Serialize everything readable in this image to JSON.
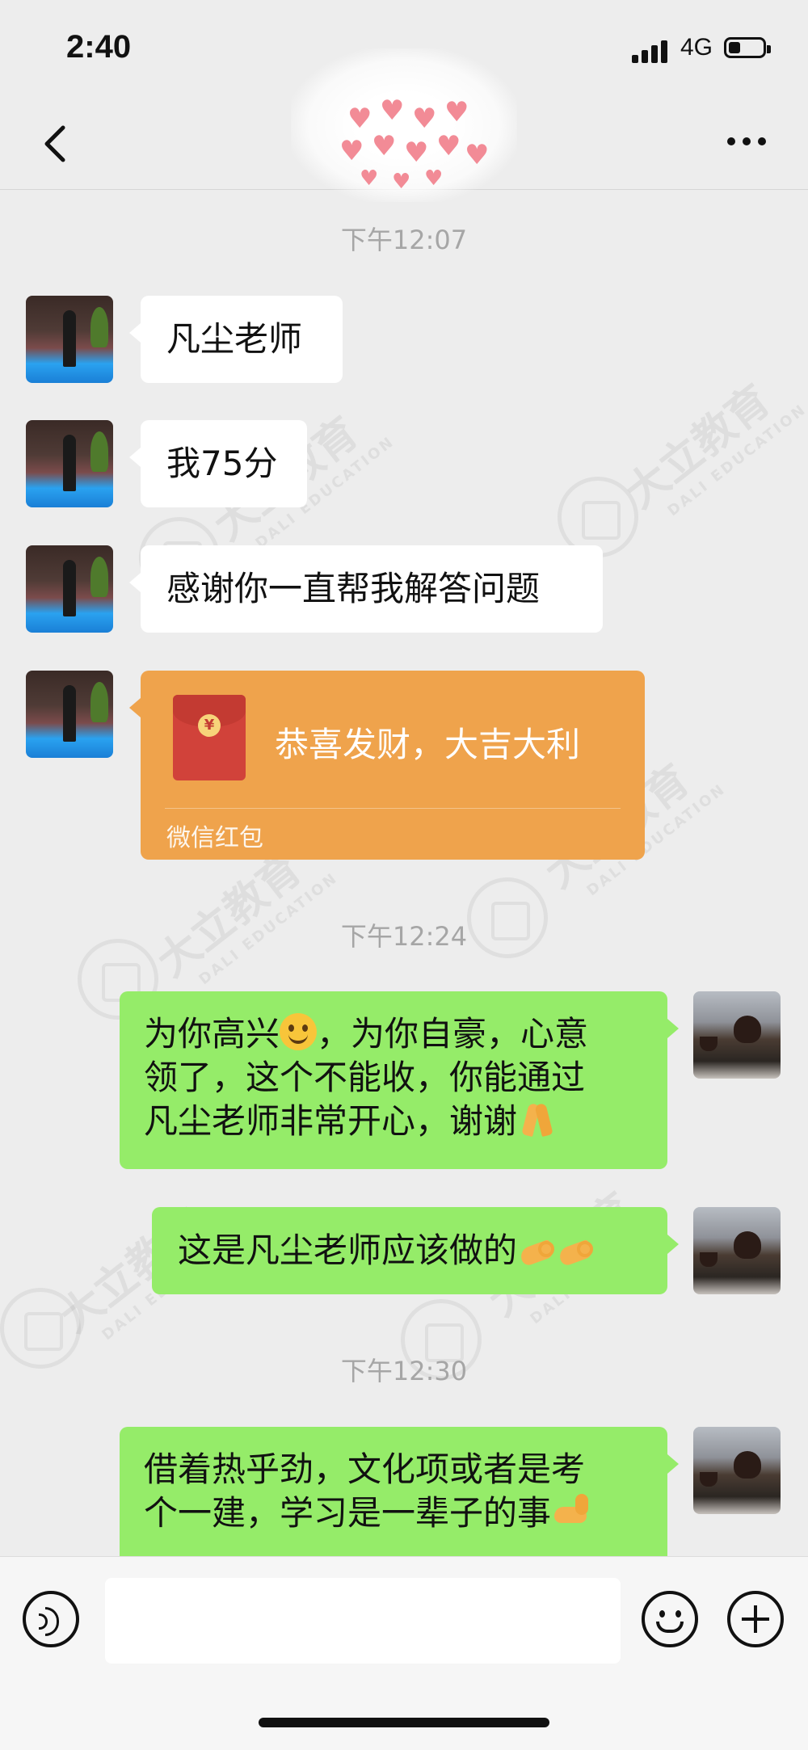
{
  "status_bar": {
    "time": "2:40",
    "network": "4G",
    "battery_level": 0.35
  },
  "nav": {
    "back_icon": "chevron-left-icon",
    "more_icon": "ellipsis-icon"
  },
  "timestamps": [
    "下午12:07",
    "下午12:24",
    "下午12:30"
  ],
  "messages": [
    {
      "side": "left",
      "text": "凡尘老师"
    },
    {
      "side": "left",
      "text": "我75分"
    },
    {
      "side": "left",
      "text": "感谢你一直帮我解答问题"
    },
    {
      "side": "left",
      "type": "red_packet",
      "text": "恭喜发财，大吉大利",
      "label": "微信红包"
    },
    {
      "side": "right",
      "lines": [
        "为你高兴",
        "，为你自豪，心意",
        "领了，这个不能收，你能通过",
        "凡尘老师非常开心，谢谢"
      ]
    },
    {
      "side": "right",
      "text": "这是凡尘老师应该做的"
    },
    {
      "side": "right",
      "lines": [
        "借着热乎劲，文化项或者是考",
        "个一建，学习是一辈子的事"
      ]
    }
  ],
  "watermark": {
    "text": "大立教育",
    "subtext": "DALI EDUCATION"
  },
  "input_bar": {
    "voice_icon": "voice-icon",
    "emoji_icon": "smile-icon",
    "add_icon": "plus-icon",
    "draft": ""
  }
}
